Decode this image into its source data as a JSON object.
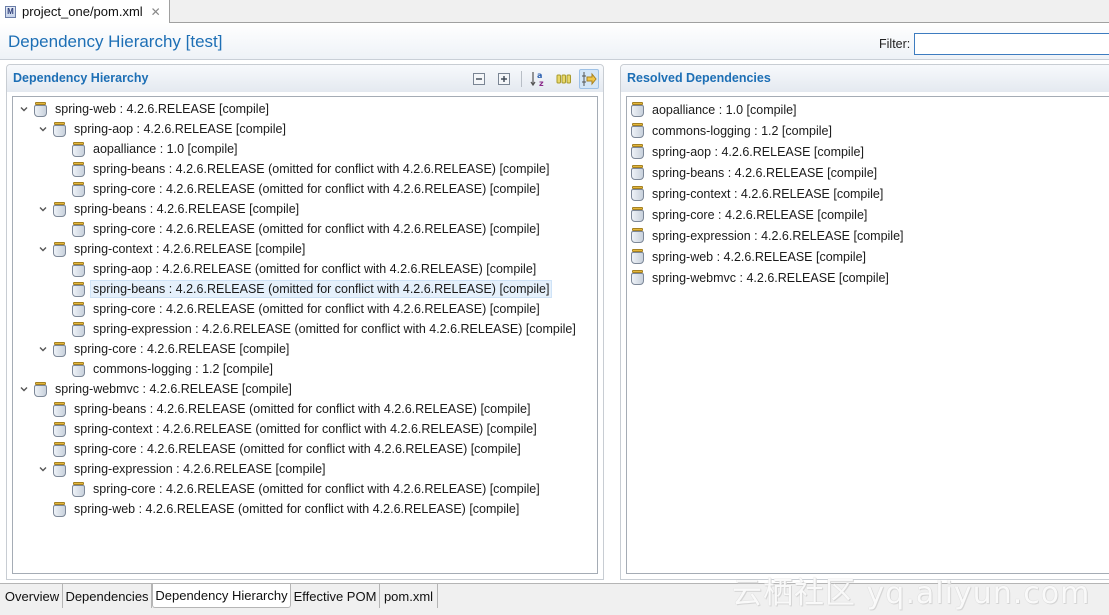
{
  "editor_tab": {
    "icon": "maven-pom-file-icon",
    "label": "project_one/pom.xml",
    "close_icon": "close-icon"
  },
  "header": {
    "title": "Dependency Hierarchy [test]",
    "filter_label": "Filter:",
    "filter_value": ""
  },
  "hierarchy": {
    "title": "Dependency Hierarchy",
    "toolbar": [
      {
        "name": "collapse-all",
        "icon": "collapse-all-icon"
      },
      {
        "name": "expand-all",
        "icon": "expand-all-icon"
      },
      {
        "name": "sort",
        "icon": "sort-alpha-icon"
      },
      {
        "name": "show-group-id",
        "icon": "group-id-icon"
      },
      {
        "name": "link-with-selection",
        "icon": "link-selection-icon",
        "active": true
      }
    ],
    "rows": [
      {
        "depth": 0,
        "expanded": true,
        "text": "spring-web : 4.2.6.RELEASE [compile]"
      },
      {
        "depth": 1,
        "expanded": true,
        "text": "spring-aop : 4.2.6.RELEASE [compile]"
      },
      {
        "depth": 2,
        "text": "aopalliance : 1.0 [compile]"
      },
      {
        "depth": 2,
        "text": "spring-beans : 4.2.6.RELEASE (omitted for conflict with 4.2.6.RELEASE) [compile]"
      },
      {
        "depth": 2,
        "text": "spring-core : 4.2.6.RELEASE (omitted for conflict with 4.2.6.RELEASE) [compile]"
      },
      {
        "depth": 1,
        "expanded": true,
        "text": "spring-beans : 4.2.6.RELEASE [compile]"
      },
      {
        "depth": 2,
        "text": "spring-core : 4.2.6.RELEASE (omitted for conflict with 4.2.6.RELEASE) [compile]"
      },
      {
        "depth": 1,
        "expanded": true,
        "text": "spring-context : 4.2.6.RELEASE [compile]"
      },
      {
        "depth": 2,
        "text": "spring-aop : 4.2.6.RELEASE (omitted for conflict with 4.2.6.RELEASE) [compile]"
      },
      {
        "depth": 2,
        "text": "spring-beans : 4.2.6.RELEASE (omitted for conflict with 4.2.6.RELEASE) [compile]",
        "selected": true
      },
      {
        "depth": 2,
        "text": "spring-core : 4.2.6.RELEASE (omitted for conflict with 4.2.6.RELEASE) [compile]"
      },
      {
        "depth": 2,
        "text": "spring-expression : 4.2.6.RELEASE (omitted for conflict with 4.2.6.RELEASE) [compile]"
      },
      {
        "depth": 1,
        "expanded": true,
        "text": "spring-core : 4.2.6.RELEASE [compile]"
      },
      {
        "depth": 2,
        "text": "commons-logging : 1.2 [compile]"
      },
      {
        "depth": 0,
        "expanded": true,
        "text": "spring-webmvc : 4.2.6.RELEASE [compile]"
      },
      {
        "depth": 1,
        "text": "spring-beans : 4.2.6.RELEASE (omitted for conflict with 4.2.6.RELEASE) [compile]"
      },
      {
        "depth": 1,
        "text": "spring-context : 4.2.6.RELEASE (omitted for conflict with 4.2.6.RELEASE) [compile]"
      },
      {
        "depth": 1,
        "text": "spring-core : 4.2.6.RELEASE (omitted for conflict with 4.2.6.RELEASE) [compile]"
      },
      {
        "depth": 1,
        "expanded": true,
        "text": "spring-expression : 4.2.6.RELEASE [compile]"
      },
      {
        "depth": 2,
        "text": "spring-core : 4.2.6.RELEASE (omitted for conflict with 4.2.6.RELEASE) [compile]"
      },
      {
        "depth": 1,
        "text": "spring-web : 4.2.6.RELEASE (omitted for conflict with 4.2.6.RELEASE) [compile]"
      }
    ]
  },
  "resolved": {
    "title": "Resolved Dependencies",
    "rows": [
      "aopalliance : 1.0 [compile]",
      "commons-logging : 1.2 [compile]",
      "spring-aop : 4.2.6.RELEASE [compile]",
      "spring-beans : 4.2.6.RELEASE [compile]",
      "spring-context : 4.2.6.RELEASE [compile]",
      "spring-core : 4.2.6.RELEASE [compile]",
      "spring-expression : 4.2.6.RELEASE [compile]",
      "spring-web : 4.2.6.RELEASE [compile]",
      "spring-webmvc : 4.2.6.RELEASE [compile]"
    ]
  },
  "bottom_tabs": [
    {
      "label": "Overview"
    },
    {
      "label": "Dependencies"
    },
    {
      "label": "Dependency Hierarchy",
      "active": true
    },
    {
      "label": "Effective POM"
    },
    {
      "label": "pom.xml"
    }
  ],
  "watermark": "云栖社区 yq.aliyun.com",
  "colors": {
    "accent": "#1d6fb5",
    "selection": "#e5f0fb",
    "jar_lid": "#e4b73c"
  }
}
